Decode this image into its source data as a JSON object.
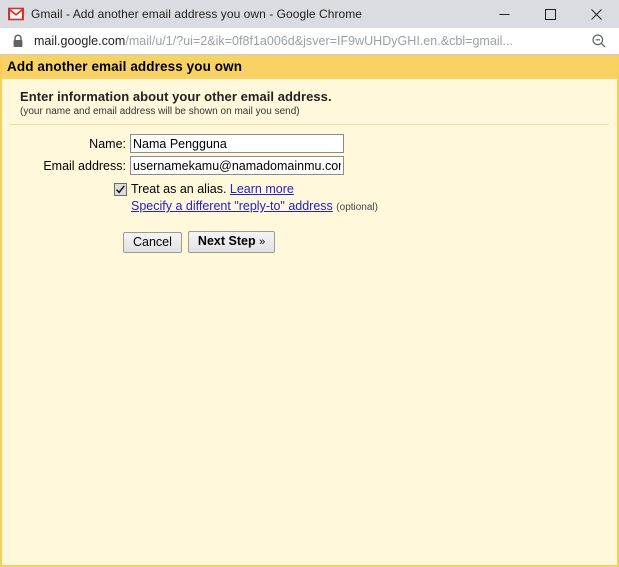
{
  "browser": {
    "window_title": "Gmail - Add another email address you own - Google Chrome",
    "favicon_name": "gmail-icon",
    "controls": {
      "minimize_label": "–",
      "maximize_label": "□",
      "close_label": "✕"
    },
    "omnibox": {
      "lock_icon": "lock-icon",
      "url_host": "mail.google.com",
      "url_path": "/mail/u/1/?ui=2&ik=0f8f1a006d&jsver=IF9wUHDyGHI.en.&cbl=gmail...",
      "url_full": "mail.google.com/mail/u/1/?ui=2&ik=0f8f1a006d&jsver=IF9wUHDyGHI.en.&cbl=gmail...",
      "zoom_icon": "zoom-out-icon"
    }
  },
  "page": {
    "header_title": "Add another email address you own",
    "intro_title": "Enter information about your other email address.",
    "intro_subtitle": "(your name and email address will be shown on mail you send)",
    "form": {
      "name_label": "Name:",
      "name_value": "Nama Pengguna",
      "email_label": "Email address:",
      "email_value": "usernamekamu@namadomainmu.com",
      "alias_checkbox_checked": "true",
      "alias_text": "Treat as an alias.",
      "alias_learn_more": "Learn more",
      "replyto_link": "Specify a different \"reply-to\" address",
      "replyto_optional": "(optional)"
    },
    "buttons": {
      "cancel": "Cancel",
      "next_step": "Next Step",
      "next_step_chevron": "»"
    }
  },
  "colors": {
    "header_band": "#f8d363",
    "page_background": "#fff8db",
    "page_border": "#f7d05c",
    "divider": "#f6dc9c",
    "link": "#2222cc",
    "titlebar": "#d9dde1"
  }
}
